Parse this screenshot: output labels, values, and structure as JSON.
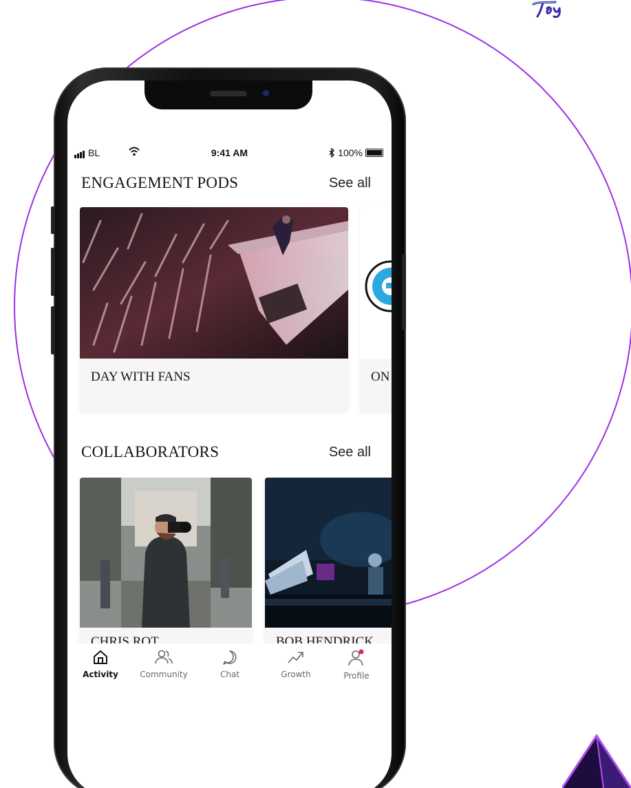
{
  "brand": {
    "corner_logo_icon": "tiger-script-logo-icon",
    "accent": "#9b30e6"
  },
  "status_bar": {
    "carrier": "BL",
    "time": "9:41 AM",
    "battery": "100%"
  },
  "engagement": {
    "title": "ENGAGEMENT PODS",
    "see_all": "See all",
    "cards": [
      {
        "label": "DAY WITH FANS",
        "image": "concert-crowd-photo"
      },
      {
        "label": "ON",
        "image": "blue-circle-logo"
      }
    ]
  },
  "collaborators": {
    "title": "COLLABORATORS",
    "see_all": "See all",
    "cards": [
      {
        "label": "CHRIS ROT",
        "image": "street-photographer-photo"
      },
      {
        "label": "BOB HENDRICK",
        "image": "piano-stage-photo"
      }
    ]
  },
  "tabbar": {
    "items": [
      {
        "label": "Activity",
        "icon": "home-icon",
        "active": true
      },
      {
        "label": "Community",
        "icon": "community-icon",
        "active": false
      },
      {
        "label": "Chat",
        "icon": "chat-icon",
        "active": false
      },
      {
        "label": "Growth",
        "icon": "growth-icon",
        "active": false
      },
      {
        "label": "Profile",
        "icon": "profile-icon",
        "active": false,
        "notification": true
      }
    ]
  }
}
